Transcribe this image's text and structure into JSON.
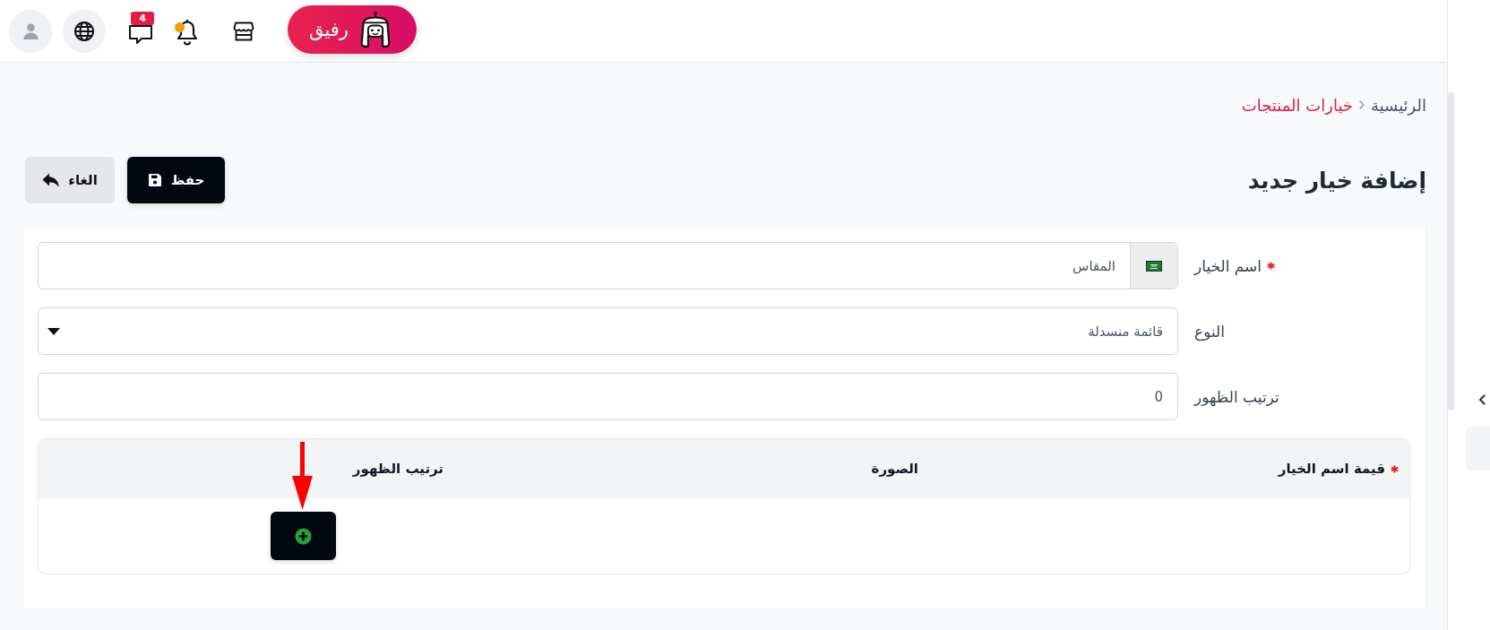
{
  "top_bar": {
    "assistant_button": {
      "label": "رفيق"
    },
    "messages": {
      "badge": "4"
    },
    "notifications": {
      "unread": true
    }
  },
  "breadcrumb": [
    {
      "label": "الرئيسية",
      "current": false
    },
    {
      "label": "خيارات المنتجات",
      "current": true
    }
  ],
  "page_title": "إضافة خيار جديد",
  "actions": [
    {
      "kind": "save",
      "label": "حفظ"
    },
    {
      "kind": "cancel",
      "label": "الغاء"
    }
  ],
  "form": {
    "fields": [
      {
        "kind": "translatable_text",
        "label": "اسم الخيار",
        "required": true,
        "value": "المقاس"
      },
      {
        "kind": "select",
        "label": "النوع",
        "required": false,
        "value": "قائمة منسدلة"
      },
      {
        "kind": "text",
        "label": "ترتيب الظهور",
        "required": false,
        "value": "0"
      }
    ]
  },
  "values_table": {
    "columns": [
      {
        "label": "قيمة اسم الخيار",
        "required": true
      },
      {
        "label": "الصورة",
        "required": false
      },
      {
        "label": "ترتيب الظهور",
        "required": false
      }
    ]
  }
}
